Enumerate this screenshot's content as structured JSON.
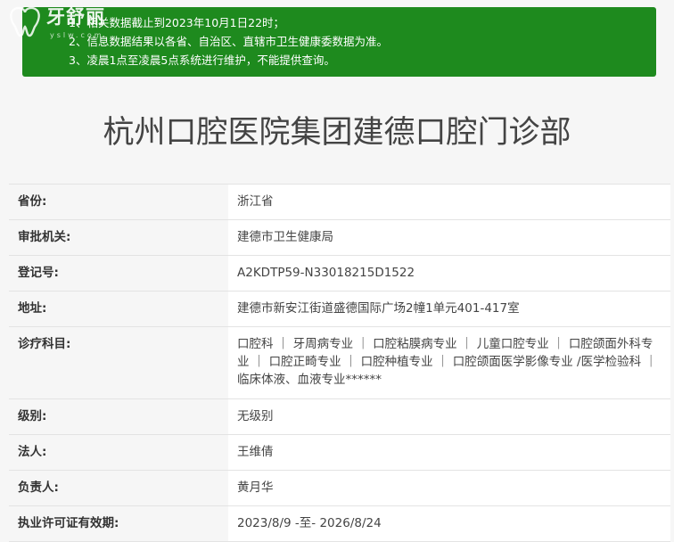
{
  "logo": {
    "text": "牙舒丽",
    "sub": "yslw.com"
  },
  "notice": {
    "lines": [
      "1、相关数据截止到2023年10月1日22时；",
      "2、信息数据结果以各省、自治区、直辖市卫生健康委数据为准。",
      "3、凌晨1点至凌晨5点系统进行维护，不能提供查询。"
    ]
  },
  "title": "杭州口腔医院集团建德口腔门诊部",
  "rows": [
    {
      "label": "省份:",
      "value": "浙江省"
    },
    {
      "label": "审批机关:",
      "value": "建德市卫生健康局"
    },
    {
      "label": "登记号:",
      "value": "A2KDTP59-N33018215D1522"
    },
    {
      "label": "地址:",
      "value": "建德市新安江街道盛德国际广场2幢1单元401-417室"
    },
    {
      "label": "诊疗科目:",
      "value": "口腔科 ｜ 牙周病专业 ｜ 口腔粘膜病专业 ｜ 儿童口腔专业 ｜ 口腔颌面外科专业 ｜ 口腔正畸专业 ｜ 口腔种植专业 ｜ 口腔颌面医学影像专业 /医学检验科 ｜ 临床体液、血液专业******"
    },
    {
      "label": "级别:",
      "value": "无级别"
    },
    {
      "label": "法人:",
      "value": "王维倩"
    },
    {
      "label": "负责人:",
      "value": "黄月华"
    },
    {
      "label": "执业许可证有效期:",
      "value": "2023/8/9 -至- 2026/8/24"
    }
  ],
  "colors": {
    "notice_bg": "#1e8a1e",
    "page_bg": "#f6f6f6"
  }
}
